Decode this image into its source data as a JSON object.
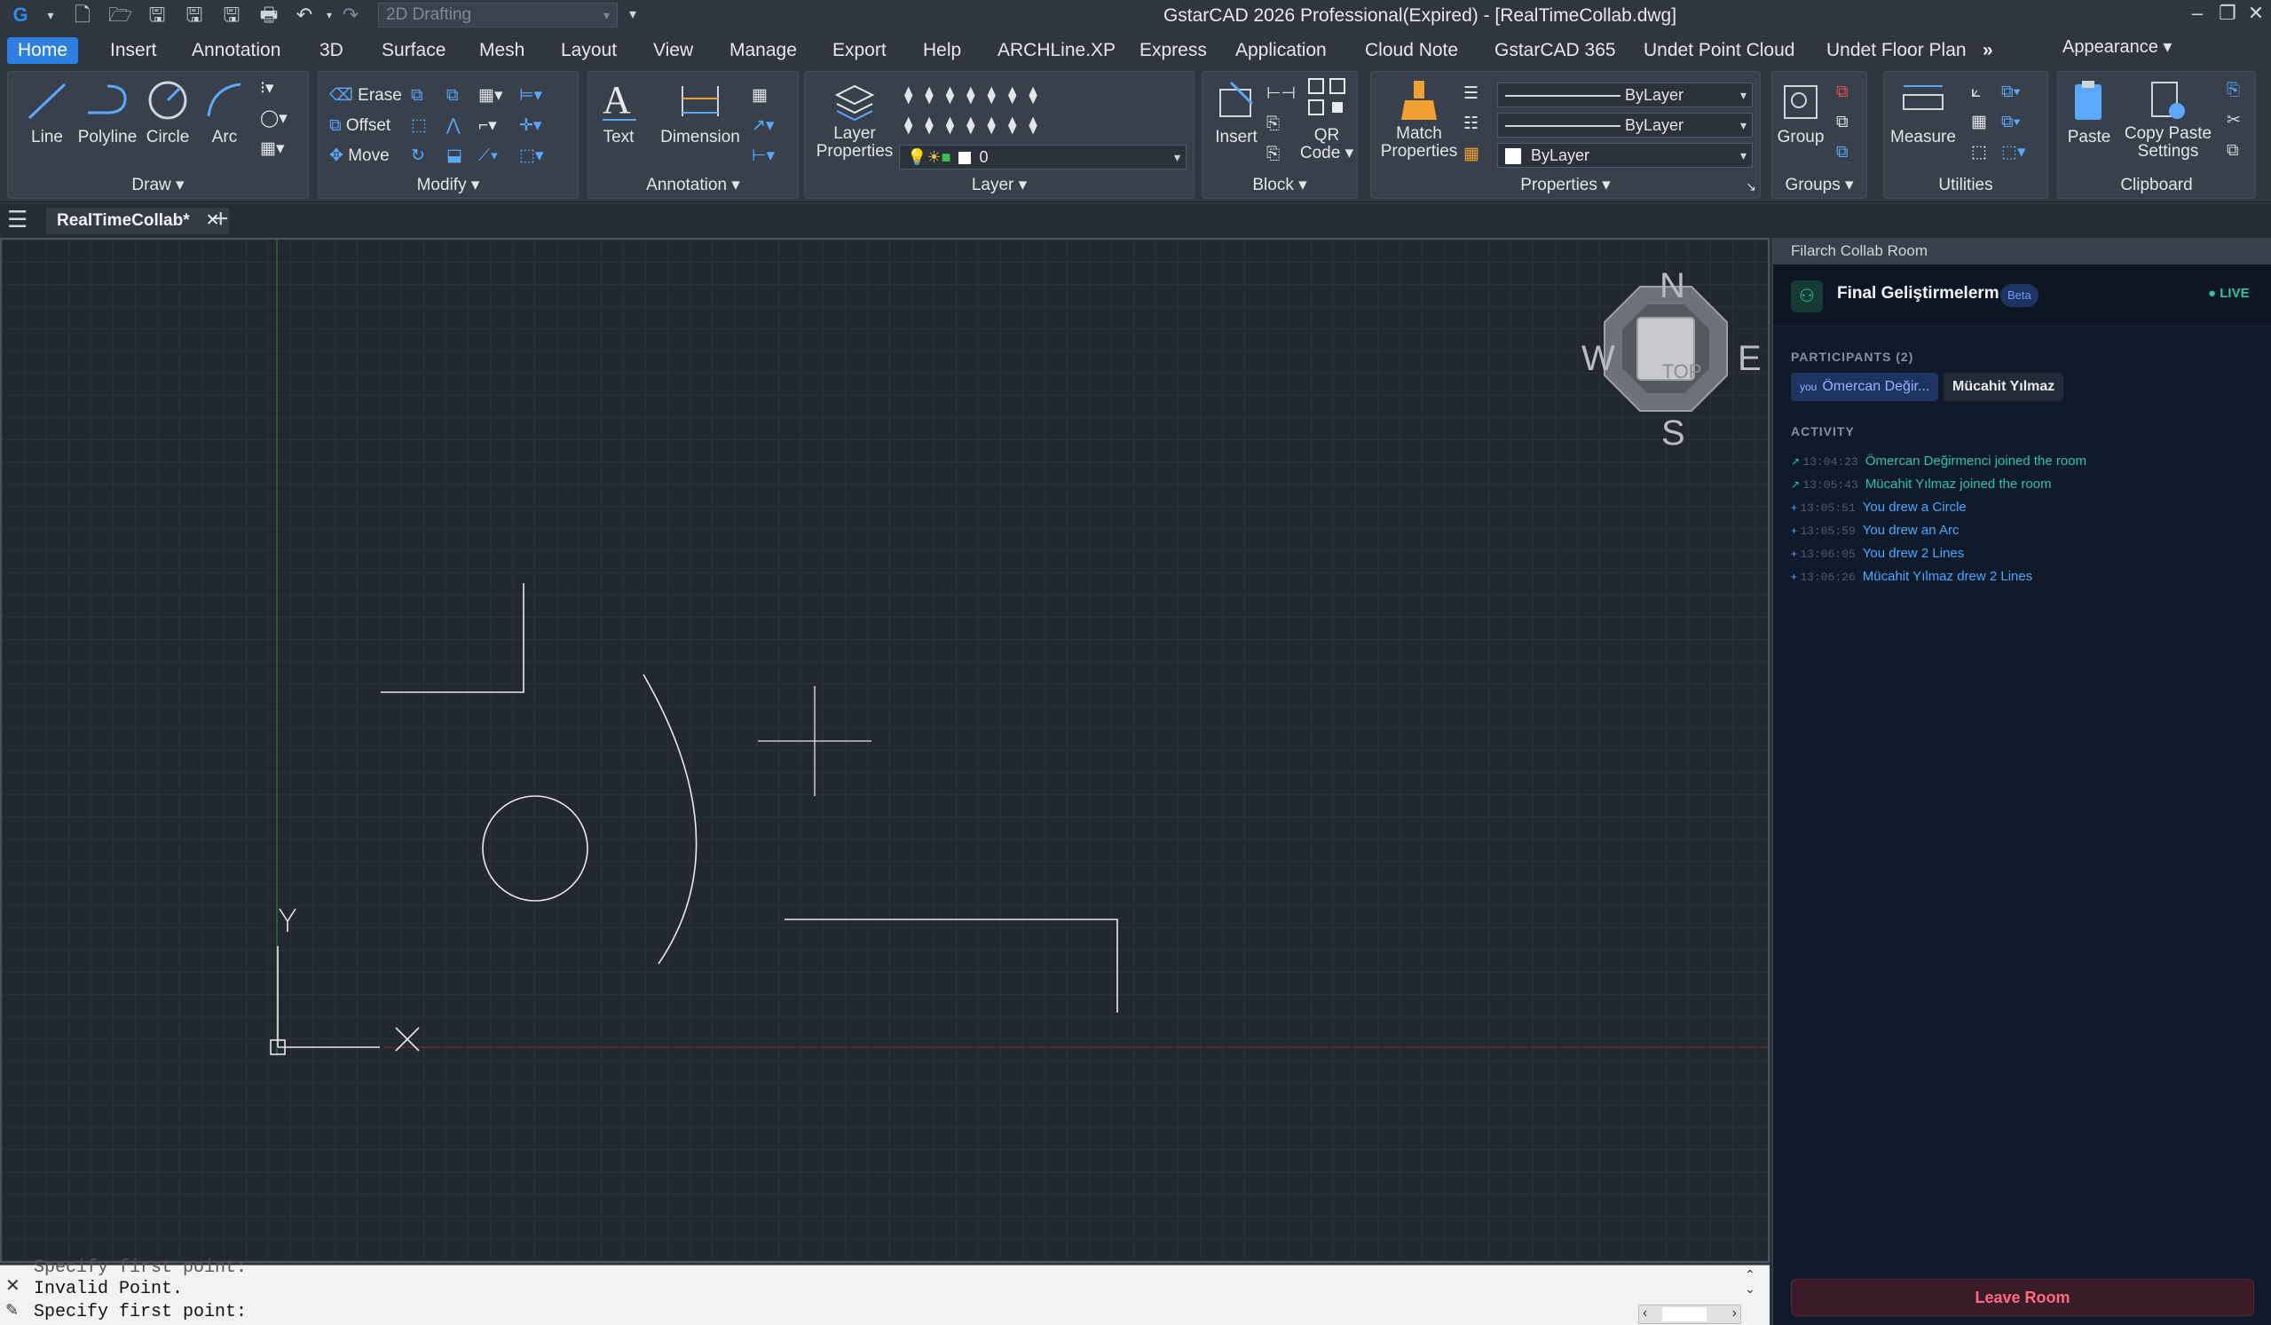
{
  "titlebar": {
    "workspace": "2D Drafting",
    "title": "GstarCAD 2026 Professional(Expired) - [RealTimeCollab.dwg]",
    "icons": [
      "app-logo-icon",
      "new-file-icon",
      "open-folder-icon",
      "save-icon",
      "save-as-icon",
      "save-all-icon",
      "print-icon",
      "undo-icon",
      "redo-icon"
    ]
  },
  "menu": {
    "tabs": [
      "Home",
      "Insert",
      "Annotation",
      "3D",
      "Surface",
      "Mesh",
      "Layout",
      "View",
      "Manage",
      "Export",
      "Help",
      "ARCHLine.XP",
      "Express",
      "Application",
      "Cloud Note",
      "GstarCAD 365",
      "Undet Point Cloud",
      "Undet Floor Plan"
    ],
    "more": "»",
    "appearance": "Appearance ▾"
  },
  "ribbon": {
    "draw": {
      "title": "Draw ▾",
      "line": "Line",
      "polyline": "Polyline",
      "circle": "Circle",
      "arc": "Arc"
    },
    "modify": {
      "title": "Modify ▾",
      "erase": "Erase",
      "offset": "Offset",
      "move": "Move"
    },
    "annotation": {
      "title": "Annotation ▾",
      "text": "Text",
      "dimension": "Dimension"
    },
    "layer": {
      "title": "Layer ▾",
      "layer_properties_1": "Layer",
      "layer_properties_2": "Properties",
      "current_layer": "0"
    },
    "block": {
      "title": "Block ▾",
      "insert": "Insert",
      "qr_1": "QR",
      "qr_2": "Code ▾"
    },
    "properties": {
      "title": "Properties ▾",
      "match_1": "Match",
      "match_2": "Properties",
      "linetype": "ByLayer",
      "lineweight": "ByLayer",
      "color": "ByLayer"
    },
    "groups": {
      "title": "Groups ▾",
      "group": "Group"
    },
    "utilities": {
      "title": "Utilities",
      "measure": "Measure"
    },
    "clipboard": {
      "title": "Clipboard",
      "paste": "Paste",
      "copy_paste_1": "Copy Paste",
      "copy_paste_2": "Settings"
    }
  },
  "document": {
    "tab": "RealTimeCollab*"
  },
  "viewcube": {
    "n": "N",
    "s": "S",
    "e": "E",
    "w": "W",
    "face": "TOP"
  },
  "ucs": {
    "x": "X",
    "y": "Y"
  },
  "collab": {
    "header": "Filarch Collab Room",
    "room_name": "Final Geliştirmelerm",
    "beta": "Beta",
    "live": "LIVE",
    "participants_label": "PARTICIPANTS (2)",
    "participants": [
      {
        "tag": "you",
        "name": "Ömercan Değir..."
      },
      {
        "tag": "",
        "name": "Mücahit Yılmaz"
      }
    ],
    "activity_label": "ACTIVITY",
    "activity": [
      {
        "time": "13:04:23",
        "text": "Ömercan Değirmenci joined the room",
        "color": "#2ec4a0"
      },
      {
        "time": "13:05:43",
        "text": "Mücahit Yılmaz joined the room",
        "color": "#2ec4a0"
      },
      {
        "time": "13:05:51",
        "text": "You drew a Circle",
        "color": "#4aa8ff"
      },
      {
        "time": "13:05:59",
        "text": "You drew an Arc",
        "color": "#4aa8ff"
      },
      {
        "time": "13:06:05",
        "text": "You drew 2 Lines",
        "color": "#4aa8ff"
      },
      {
        "time": "13:06:26",
        "text": "Mücahit Yılmaz drew 2 Lines",
        "color": "#4aa8ff"
      }
    ],
    "leave": "Leave Room"
  },
  "command": {
    "history_1": "Specify first point:",
    "history_2": "Invalid Point.",
    "prompt": "Specify first point:"
  }
}
